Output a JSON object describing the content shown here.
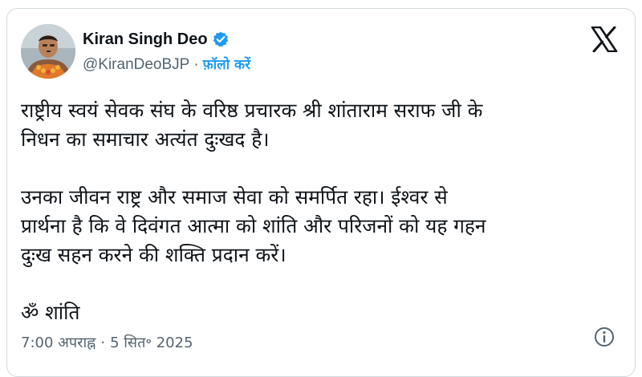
{
  "author": {
    "display_name": "Kiran Singh Deo",
    "handle": "@KiranDeoBJP",
    "separator": "·",
    "follow_label": "फ़ॉलो करें",
    "verified": true
  },
  "icons": {
    "verified": "verified-badge-icon",
    "platform": "x-logo-icon",
    "info": "info-icon"
  },
  "tweet": {
    "paragraphs": [
      "राष्ट्रीय स्वयं सेवक संघ के वरिष्ठ प्रचारक श्री शांताराम सराफ जी के\nनिधन का समाचार अत्यंत दुःखद है।",
      "उनका जीवन राष्ट्र और समाज सेवा को समर्पित रहा। ईश्वर से\nप्रार्थना है कि वे दिवंगत आत्मा को शांति और परिजनों को यह गहन\nदुःख सहन करने की शक्ति प्रदान करें।",
      "ॐ शांति"
    ]
  },
  "meta": {
    "time": "7:00 अपराह्न",
    "separator": "·",
    "date": "5 सित॰ 2025"
  },
  "colors": {
    "accent": "#1d9bf0",
    "text": "#0f1419",
    "secondary": "#536471",
    "border": "#cfd9de"
  }
}
